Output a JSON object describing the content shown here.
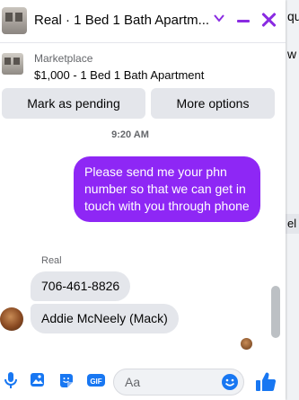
{
  "background": {
    "fragments": [
      "qui",
      "w",
      "el"
    ]
  },
  "header": {
    "title": "Real · 1 Bed 1 Bath Apartm..."
  },
  "marketplace": {
    "label": "Marketplace",
    "price_line": "$1,000 - 1 Bed 1 Bath Apartment",
    "pending_label": "Mark as pending",
    "more_label": "More options"
  },
  "messages": {
    "timestamp": "9:20 AM",
    "outgoing": "Please send me your phn number so that we can get in touch with you through phone",
    "sender": "Real",
    "incoming": [
      "706-461-8826",
      "Addie McNeely (Mack)"
    ]
  },
  "composer": {
    "placeholder": "Aa",
    "gif_label": "GIF"
  },
  "colors": {
    "accent": "#8a2be2",
    "bubble_out": "#8e27f5",
    "icon_blue": "#1877f2"
  },
  "icons": [
    "chevron-down-icon",
    "minimize-icon",
    "close-icon",
    "mic-icon",
    "photo-icon",
    "sticker-icon",
    "gif-icon",
    "emoji-icon",
    "thumbs-up-icon"
  ]
}
